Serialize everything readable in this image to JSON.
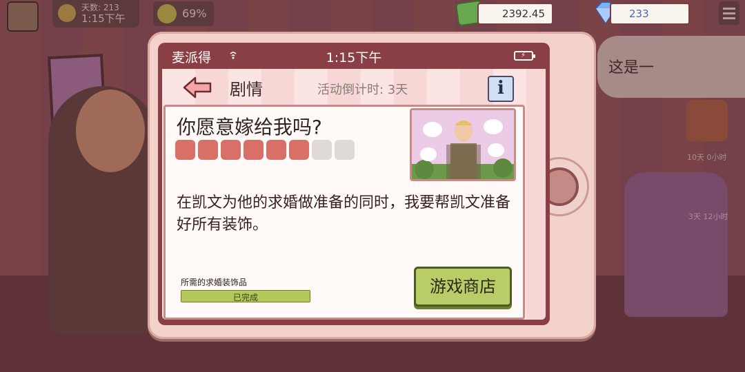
{
  "hud": {
    "day_label": "天数: 213",
    "time": "1:15下午",
    "mood_percent": "69%",
    "cash": "2392.45",
    "gems": "233"
  },
  "background": {
    "speech_text": "这是一",
    "timer_a": "10天 0小时",
    "timer_b": "3天 12小时"
  },
  "phone": {
    "carrier": "麦派得",
    "clock": "1:15下午",
    "nav": {
      "title": "剧情",
      "countdown": "活动倒计时: 3天",
      "info_label": "i"
    },
    "story": {
      "headline": "你愿意嫁给我吗?",
      "progress_steps_total": 8,
      "progress_steps_done": 6,
      "description": "在凯文为他的求婚做准备的同时，我要帮凯文准备好所有装饰。",
      "requirement_label": "所需的求婚装饰品",
      "requirement_status": "已完成",
      "requirement_progress": 1.0,
      "shop_button": "游戏商店"
    }
  },
  "colors": {
    "phone_frame": "#8a3e45",
    "progress_on": "#d97067",
    "progress_off": "#dedad8",
    "shop_button": "#b8cd67"
  }
}
